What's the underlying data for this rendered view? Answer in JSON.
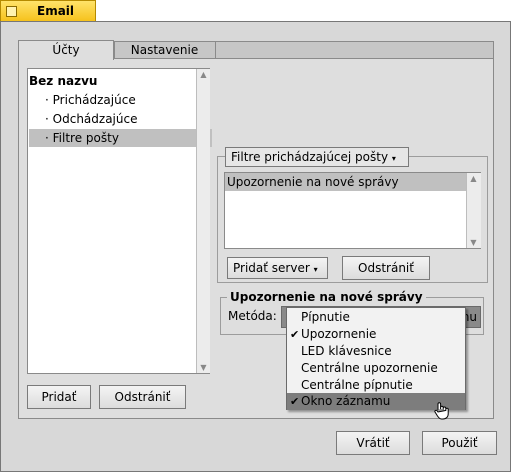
{
  "window": {
    "title": "Email"
  },
  "tabs": [
    {
      "label": "Účty"
    },
    {
      "label": "Nastavenie"
    }
  ],
  "accounts": {
    "items": [
      {
        "label": "Bez nazvu",
        "bullet": ""
      },
      {
        "label": "Prichádzajúce",
        "bullet": "·"
      },
      {
        "label": "Odchádzajúce",
        "bullet": "·"
      },
      {
        "label": "Filtre pošty",
        "bullet": "·"
      }
    ],
    "selected_index": 3
  },
  "left_buttons": {
    "add": "Pridať",
    "remove": "Odstrániť"
  },
  "filter": {
    "dropdown_label": "Filtre prichádzajúcej pošty",
    "list": [
      "Upozornenie na nové správy"
    ],
    "add_server": "Pridať server",
    "remove": "Odstrániť"
  },
  "notify": {
    "title": "Upozornenie na nové správy",
    "method_label": "Metóda:",
    "method_value_tail": "mu",
    "options": [
      {
        "label": "Pípnutie",
        "checked": false
      },
      {
        "label": "Upozornenie",
        "checked": true
      },
      {
        "label": "LED klávesnice",
        "checked": false
      },
      {
        "label": "Centrálne upozornenie",
        "checked": false
      },
      {
        "label": "Centrálne pípnutie",
        "checked": false
      },
      {
        "label": "Okno záznamu",
        "checked": true
      }
    ],
    "highlighted_index": 5
  },
  "footer": {
    "revert": "Vrátiť",
    "apply": "Použiť"
  },
  "colors": {
    "tab_yellow": "#f6c21c",
    "selection": "#c0c0c0",
    "menu_highlight": "#7d7d7d"
  }
}
